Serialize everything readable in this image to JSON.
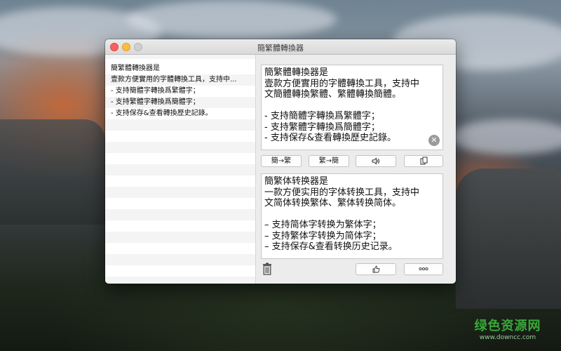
{
  "window": {
    "title": "簡繁體轉換器"
  },
  "history": {
    "items": [
      "簡繁體轉換器是",
      "壹款方便實用的字體轉換工具，支持中...",
      "- 支持簡體字轉換爲繁體字；",
      "- 支持繁體字轉換爲簡體字；",
      "- 支持保存&查看轉換歷史記錄。"
    ]
  },
  "source_text": {
    "lines": [
      "簡繁體轉換器是",
      "壹款方便實用的字體轉換工具，支持中",
      "文簡體轉換繁體、繁體轉換簡體。",
      "",
      "- 支持簡體字轉換爲繁體字；",
      "- 支持繁體字轉換爲簡體字；",
      "- 支持保存&查看轉換歷史記錄。"
    ]
  },
  "result_text": {
    "lines": [
      "簡繁体转换器是",
      "一款方便实用的字体转换工具，支持中",
      "文简体转换繁体、繁体转换简体。",
      "",
      "– 支持简体字转换为繁体字；",
      "– 支持繁体字转换为简体字；",
      "– 支持保存&查看转换历史记录。"
    ]
  },
  "toolbar": {
    "to_traditional_label": "簡→繁",
    "to_simplified_label": "繁→簡",
    "speak_icon": "speaker-icon",
    "copy_icon": "copy-icon"
  },
  "bottom_bar": {
    "trash_icon": "trash-icon",
    "like_icon": "thumbs-up-icon",
    "more_icon": "more-icon"
  },
  "watermark": {
    "name": "绿色资源网",
    "url": "www.downcc.com"
  },
  "colors": {
    "close": "#fc605c",
    "minimize": "#fdbc40",
    "zoom_disabled": "#cfcfcf",
    "watermark_green": "#3aa83a"
  }
}
